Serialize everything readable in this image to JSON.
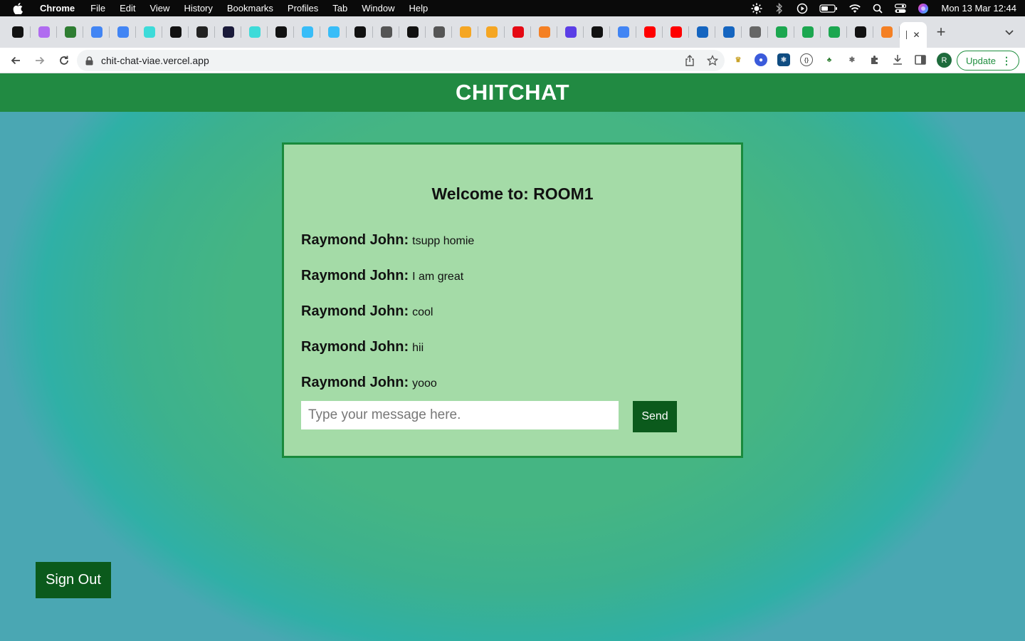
{
  "menubar": {
    "app_name": "Chrome",
    "items": [
      "File",
      "Edit",
      "View",
      "History",
      "Bookmarks",
      "Profiles",
      "Tab",
      "Window",
      "Help"
    ],
    "clock": "Mon 13 Mar  12:44"
  },
  "browser": {
    "url": "chit-chat-viae.vercel.app",
    "update_label": "Update",
    "profile_initial": "R",
    "tabs": [
      {
        "icon": "circle-a-icon",
        "color": "#111111",
        "glyph": "A"
      },
      {
        "icon": "hex-icon",
        "color": "#b06cf0",
        "glyph": "⬡"
      },
      {
        "icon": "infinity-icon",
        "color": "#2e7d32",
        "glyph": "∞"
      },
      {
        "icon": "google-icon",
        "color": "#4285f4",
        "glyph": "G"
      },
      {
        "icon": "google-icon",
        "color": "#4285f4",
        "glyph": "G"
      },
      {
        "icon": "square-icon",
        "color": "#3ddbd9",
        "glyph": "▢"
      },
      {
        "icon": "n-icon",
        "color": "#111111",
        "glyph": "N"
      },
      {
        "icon": "dark-icon",
        "color": "#222222",
        "glyph": "◉"
      },
      {
        "icon": "a-icon",
        "color": "#1a1a3a",
        "glyph": "A"
      },
      {
        "icon": "square-icon",
        "color": "#3ddbd9",
        "glyph": "▢"
      },
      {
        "icon": "medium-icon",
        "color": "#111111",
        "glyph": "M"
      },
      {
        "icon": "wave-icon",
        "color": "#38bdf8",
        "glyph": "≈"
      },
      {
        "icon": "wave-icon",
        "color": "#38bdf8",
        "glyph": "≈"
      },
      {
        "icon": "unsplash-icon",
        "color": "#111111",
        "glyph": "▙"
      },
      {
        "icon": "mask-icon",
        "color": "#555555",
        "glyph": "⌂"
      },
      {
        "icon": "circle-a-icon",
        "color": "#111111",
        "glyph": "A"
      },
      {
        "icon": "mask-icon",
        "color": "#555555",
        "glyph": "⌂"
      },
      {
        "icon": "firebase-icon",
        "color": "#f5a623",
        "glyph": "▲"
      },
      {
        "icon": "firebase-icon",
        "color": "#f5a623",
        "glyph": "▲"
      },
      {
        "icon": "netlify-icon",
        "color": "#e50914",
        "glyph": "◧"
      },
      {
        "icon": "stack-icon",
        "color": "#f48024",
        "glyph": "≡"
      },
      {
        "icon": "layers-icon",
        "color": "#5b3ee6",
        "glyph": "◈"
      },
      {
        "icon": "fr-icon",
        "color": "#111111",
        "glyph": "FR"
      },
      {
        "icon": "google-icon",
        "color": "#4285f4",
        "glyph": "G"
      },
      {
        "icon": "youtube-icon",
        "color": "#ff0000",
        "glyph": "▶"
      },
      {
        "icon": "youtube-icon",
        "color": "#ff0000",
        "glyph": "▶"
      },
      {
        "icon": "f-icon",
        "color": "#1565c0",
        "glyph": "f"
      },
      {
        "icon": "globe-icon",
        "color": "#1565c0",
        "glyph": "●"
      },
      {
        "icon": "globe-icon",
        "color": "#666666",
        "glyph": "◍"
      },
      {
        "icon": "w-icon",
        "color": "#1ca750",
        "glyph": "W"
      },
      {
        "icon": "w-icon",
        "color": "#1ca750",
        "glyph": "W"
      },
      {
        "icon": "w-icon",
        "color": "#1ca750",
        "glyph": "W"
      },
      {
        "icon": "circle-a-icon",
        "color": "#111111",
        "glyph": "A"
      },
      {
        "icon": "stack-icon",
        "color": "#f48024",
        "glyph": "≡"
      }
    ],
    "active_tab_close": "✕",
    "new_tab": "+"
  },
  "app": {
    "title": "CHITCHAT",
    "room_title": "Welcome to: ROOM1",
    "messages": [
      {
        "author": "Raymond John:",
        "text": "tsupp homie"
      },
      {
        "author": "Raymond John:",
        "text": "I am great"
      },
      {
        "author": "Raymond John:",
        "text": "cool"
      },
      {
        "author": "Raymond John:",
        "text": "hii"
      },
      {
        "author": "Raymond John:",
        "text": "yooo"
      }
    ],
    "input_placeholder": "Type your message here.",
    "send_label": "Send",
    "signout_label": "Sign Out"
  },
  "colors": {
    "header_bg": "#218a42",
    "chat_bg": "#a4dba7",
    "chat_border": "#198a3c",
    "button_bg": "#0b5a1c"
  }
}
